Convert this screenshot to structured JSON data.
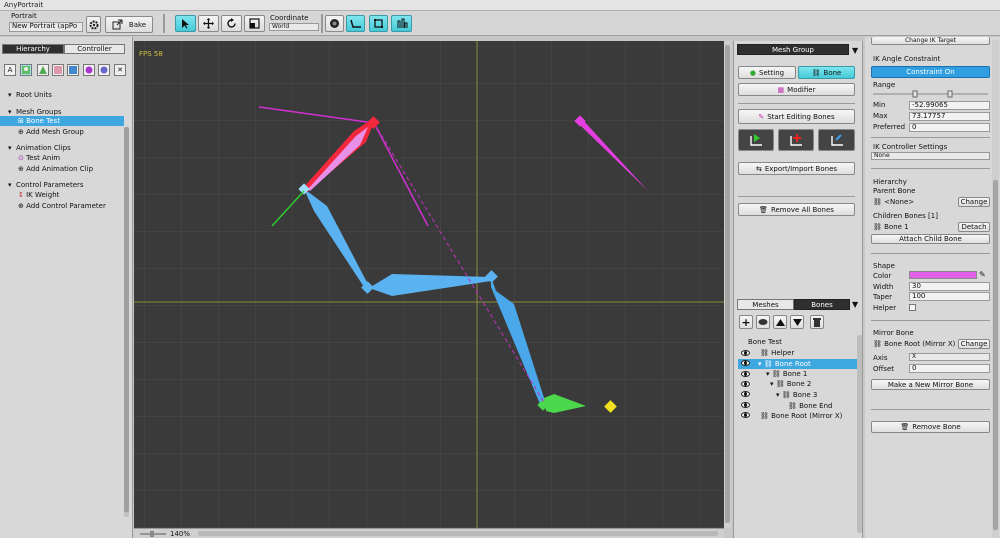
{
  "app": {
    "title": "AnyPortrait"
  },
  "toolbar": {
    "portrait_label": "Portrait",
    "portrait_value": "New Portrait (apPo",
    "bake_label": "Bake",
    "coordinate_label": "Coordinate",
    "coordinate_value": "World"
  },
  "left": {
    "tabs": [
      "Hierarchy",
      "Controller"
    ],
    "root_units": "Root Units",
    "mesh_groups": "Mesh Groups",
    "bone_test": "Bone Test",
    "add_mesh_group": "Add Mesh Group",
    "animation_clips": "Animation Clips",
    "test_anim": "Test Anim",
    "add_animation_clip": "Add Animation Clip",
    "control_parameters": "Control Parameters",
    "ik_weight": "IK Weight",
    "add_control_parameter": "Add Control Parameter"
  },
  "viewport": {
    "fps": "FPS 58",
    "zoom": "140%"
  },
  "mid": {
    "mesh_group_tab": "Mesh Group",
    "setting": "Setting",
    "bone": "Bone",
    "modifier": "Modifier",
    "start_editing_bones": "Start Editing Bones",
    "export_import_bones": "Export/Import Bones",
    "remove_all_bones": "Remove All Bones",
    "meshes_tab": "Meshes",
    "bones_tab": "Bones",
    "tree": [
      "Bone Test",
      "Helper",
      "Bone Root",
      "Bone 1",
      "Bone 2",
      "Bone 3",
      "Bone End",
      "Bone Root (Mirror X)"
    ]
  },
  "right": {
    "change_ik_target": "Change IK Target",
    "ik_angle_constraint": "IK Angle Constraint",
    "constraint_on": "Constraint On",
    "range": "Range",
    "min_label": "Min",
    "min_value": "-52.99065",
    "max_label": "Max",
    "max_value": "73.17757",
    "preferred_label": "Preferred",
    "preferred_value": "0",
    "ik_controller_settings": "IK Controller Settings",
    "ik_controller_value": "None",
    "hierarchy": "Hierarchy",
    "parent_bone": "Parent Bone",
    "parent_none": "<None>",
    "change": "Change",
    "children_bones": "Children Bones [1]",
    "child_bone1": "Bone 1",
    "detach": "Detach",
    "attach_child_bone": "Attach Child Bone",
    "shape": "Shape",
    "color_label": "Color",
    "color_value": "#e060e8",
    "width_label": "Width",
    "width_value": "30",
    "taper_label": "Taper",
    "taper_value": "100",
    "helper_label": "Helper",
    "mirror_bone": "Mirror Bone",
    "mirror_value": "Bone Root (Mirror X)",
    "change2": "Change",
    "axis_label": "Axis",
    "axis_value": "X",
    "offset_label": "Offset",
    "offset_value": "0",
    "make_mirror": "Make a New Mirror Bone",
    "remove_bone": "Remove Bone"
  }
}
